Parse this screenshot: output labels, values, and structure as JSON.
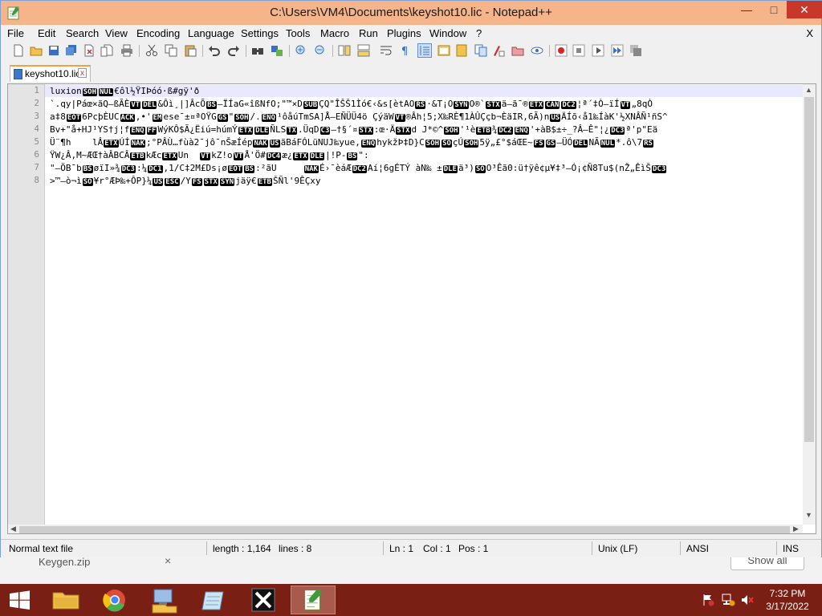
{
  "window": {
    "title": "C:\\Users\\VM4\\Documents\\keyshot10.lic - Notepad++",
    "minimize": "—",
    "maximize": "□",
    "close": "✕"
  },
  "menubar": {
    "items": [
      "File",
      "Edit",
      "Search",
      "View",
      "Encoding",
      "Language",
      "Settings",
      "Tools",
      "Macro",
      "Run",
      "Plugins",
      "Window",
      "?"
    ],
    "close_doc": "X"
  },
  "tab": {
    "label": "keyshot10.lic",
    "close": "x"
  },
  "editor": {
    "line_numbers": [
      "1",
      "2",
      "3",
      "4",
      "5",
      "6",
      "7",
      "8"
    ],
    "lines": [
      "luxion[SOH][NUL]€ôl½ŸIÞóó·ß#gÿ'ð",
      "`.qy|Páœ×ãQ—ßÃÈ[VT][DEL]&Ôì¸|]ÂcÕ[BS]—ÏÍaG«îßNfO;\"™×D[SUB]ÇQ\"ÎŠŠ1Ìó€‹&s[ètAO[RS]·&T¡O[SYN]O®`[STX]ä—ã¯®[ETX][CAN][DC2]¦ª´‡Ò—ïÍ[VT]„8qÒ",
      "a‡8[EOT]6PcþÈUC[ACK],•'[EM]ese¯±¤ªOŸG[GS]\"[SOH]/.[ENQ]¹ôåúTmSA]Å—EÑÜÜ4ö ÇýäW[VT]®Âh¦5;X‰RÈ¶1ÀÛÇçb¬ÈäIR,6Ã)n[US]ÄÍõ‹å1‰ÍàK'½XNÂÑ¹ñS^",
      "Bv+\"å+HJ¹YS†j¦f[ENQ][FF]WýKÔ$Ã¿Ëiú=húmÝ[ETX][DLE]ÑLS[TX].ÜqD[C3]—†§´¤[STX]:œ·Ä[STX]d J*©^[SOH]'¹è[ETB]¾[DC2][ENQ]'+àB$±÷_?Â—Ê\"¦¿[DC3]ª'p\"Eä",
      "Ü¨¶h    lÂ[ETX]ÚÍ[NAK];°PÂÙ…fùà2¯jô¯nŠæÍép[NAK][US]ãBáFÓLüNUJ‰yue,[ENQ]hykžÞ‡D}C[SOH][SO]çÚ[SOH]5ÿ„£°$áŒE~[FS][GS]—ÜÓ[DEL]NÃ[NUL]*.ô\\7[RS]",
      "ŸW¿Â,M~ÆŒ†àÂBCÂ[ETB]kÆc[ETX]Un  [VT]kZ!o[VT]Å'Ö#[DC4]æ¿[ETX][DLE]|!P-[BS]\":",
      "\"–ÖB¯b[BS]øïI»¾[DC3]:¼[DC1],1/C‡2M£Ds¡ø[EOT][BS]:²ãU     [NAK]É›¯èáÆ[DC2]Aí¦6gÉTÝ àN‰ ±[DLE]ä³)[SO]O³Êã0:ü†ÿê¢µ¥‡³—Ó¡¢Ñ8Tu$(nŽ„ÊìŠ[DC3]",
      ">™—ò¬ì[SO]¥r°ÆÞ‰+ÔP}¼[US][ESC]/Y[FS][STX][SYN]jäÿ€[ETB]ŠÑl'9ÊÇxy"
    ]
  },
  "statusbar": {
    "file_type": "Normal text file",
    "length": "length : 1,164",
    "lines": "lines : 8",
    "ln": "Ln : 1",
    "col": "Col : 1",
    "pos": "Pos : 1",
    "eol": "Unix (LF)",
    "encoding": "ANSI",
    "mode": "INS"
  },
  "download_bar": {
    "file": "Keygen.zip",
    "show_all": "Show all"
  },
  "taskbar": {
    "time": "7:32 PM",
    "date": "3/17/2022",
    "apps": [
      "start",
      "file-explorer",
      "chrome",
      "network-folder",
      "notepad",
      "xming",
      "notepad-plus-plus"
    ]
  },
  "colors": {
    "titlebar": "#f5b48a",
    "taskbar": "#7a1f14",
    "current_line": "#e8e8ff",
    "tab_accent": "#f5a040"
  }
}
